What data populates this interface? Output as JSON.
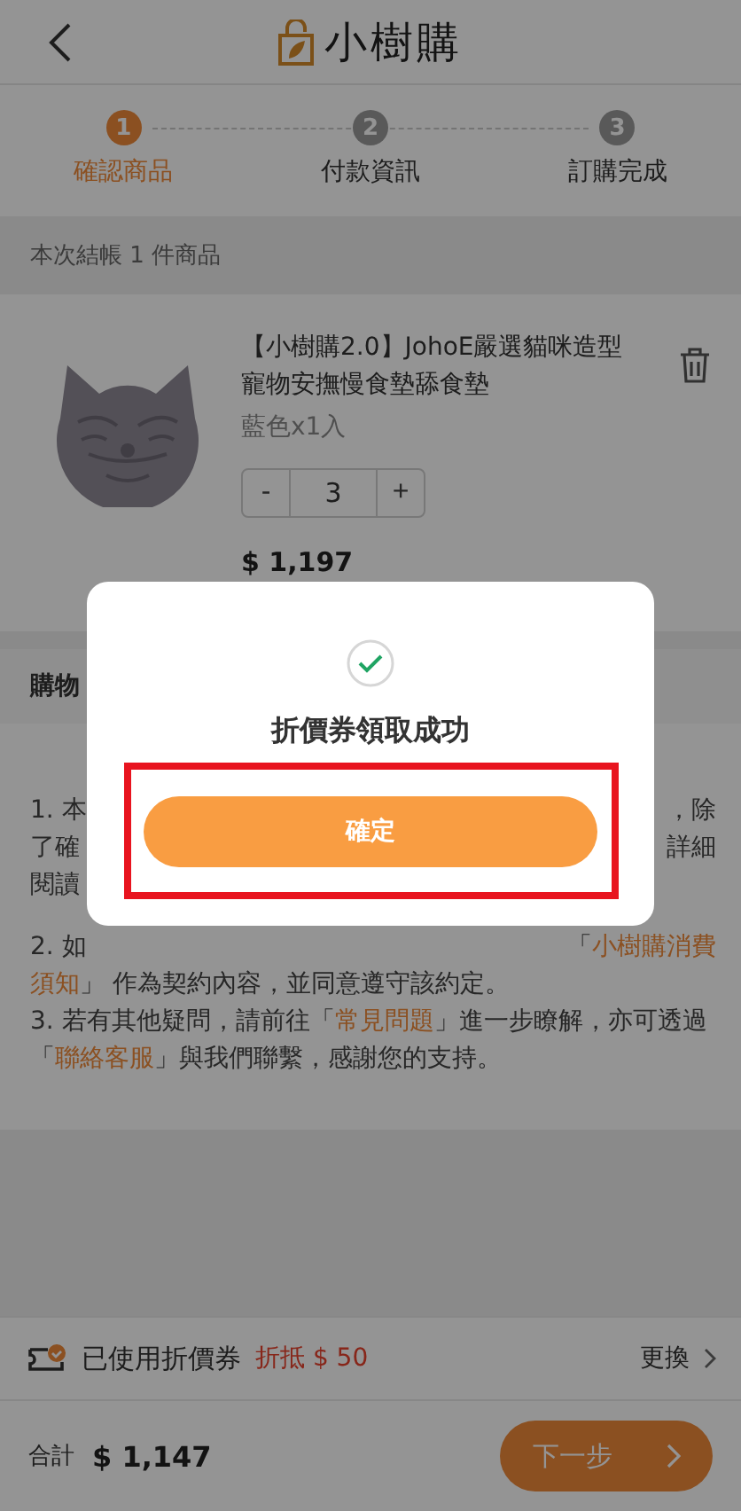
{
  "header": {
    "title": "小樹購"
  },
  "steps": [
    {
      "number": "1",
      "label": "確認商品",
      "selected": true
    },
    {
      "number": "2",
      "label": "付款資訊",
      "selected": false
    },
    {
      "number": "3",
      "label": "訂購完成",
      "selected": false
    }
  ],
  "summary": "本次結帳 1 件商品",
  "product": {
    "name": "【小樹購2.0】JohoE嚴選貓咪造型寵物安撫慢食墊舔食墊",
    "variant": "藍色x1入",
    "minus": "-",
    "quantity": "3",
    "plus": "+",
    "price": "$ 1,197"
  },
  "notes": {
    "title": "購物",
    "lines": [
      {
        "left": [
          {
            "text": "1. 本",
            "link": false
          }
        ],
        "right": [
          {
            "text": "，除",
            "link": false
          }
        ]
      },
      {
        "left": [
          {
            "text": "了確",
            "link": false
          }
        ],
        "right": [
          {
            "text": "詳細",
            "link": false
          }
        ]
      },
      {
        "left": [
          {
            "text": "閱讀",
            "link": false
          }
        ]
      },
      {
        "left": [
          {
            "text": "2. 如",
            "link": false
          }
        ],
        "right": [
          {
            "text": "「",
            "link": false
          },
          {
            "text": "小樹購消費",
            "link": true
          }
        ]
      },
      {
        "left": [
          {
            "text": "須知",
            "link": true
          },
          {
            "text": "」 作為契約內容，並同意遵守該約定。",
            "link": false
          }
        ]
      },
      {
        "left": [
          {
            "text": "3. 若有其他疑問，請前往「",
            "link": false
          },
          {
            "text": "常見問題",
            "link": true
          },
          {
            "text": "」進一步瞭解，亦可透過",
            "link": false
          }
        ]
      },
      {
        "left": [
          {
            "text": "「",
            "link": false
          },
          {
            "text": "聯絡客服",
            "link": true
          },
          {
            "text": "」與我們聯繫，感謝您的支持。",
            "link": false
          }
        ]
      }
    ]
  },
  "coupon": {
    "label": "已使用折價券",
    "discount": "折抵 $ 50",
    "action": "更換"
  },
  "footer": {
    "total_label": "合計",
    "total": "$ 1,147",
    "next": "下一步"
  },
  "dialog": {
    "message": "折價券領取成功",
    "confirm": "確定"
  }
}
